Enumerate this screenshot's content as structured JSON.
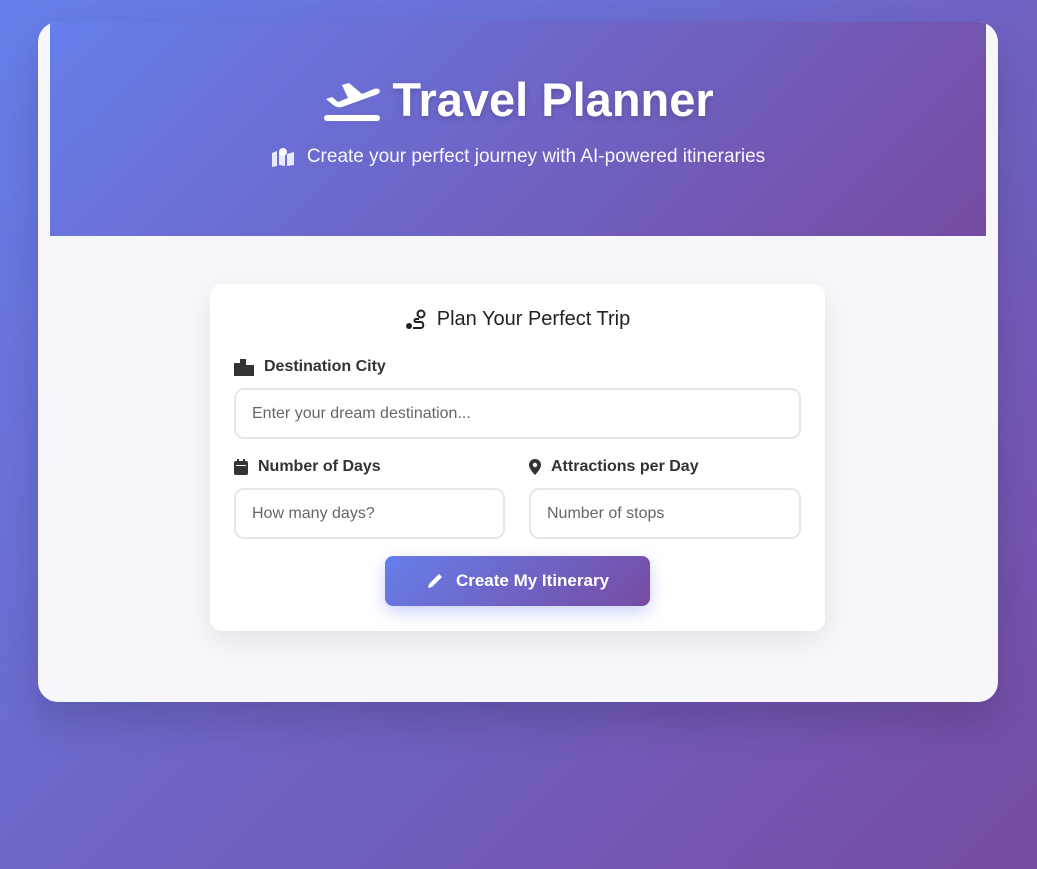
{
  "header": {
    "title": "Travel Planner",
    "subtitle": "Create your perfect journey with AI-powered itineraries"
  },
  "form": {
    "title": "Plan Your Perfect Trip",
    "destination": {
      "label": "Destination City",
      "placeholder": "Enter your dream destination..."
    },
    "days": {
      "label": "Number of Days",
      "placeholder": "How many days?"
    },
    "attractions": {
      "label": "Attractions per Day",
      "placeholder": "Number of stops"
    },
    "submit_label": "Create My Itinerary"
  },
  "colors": {
    "gradient_start": "#667eea",
    "gradient_end": "#764ba2"
  }
}
